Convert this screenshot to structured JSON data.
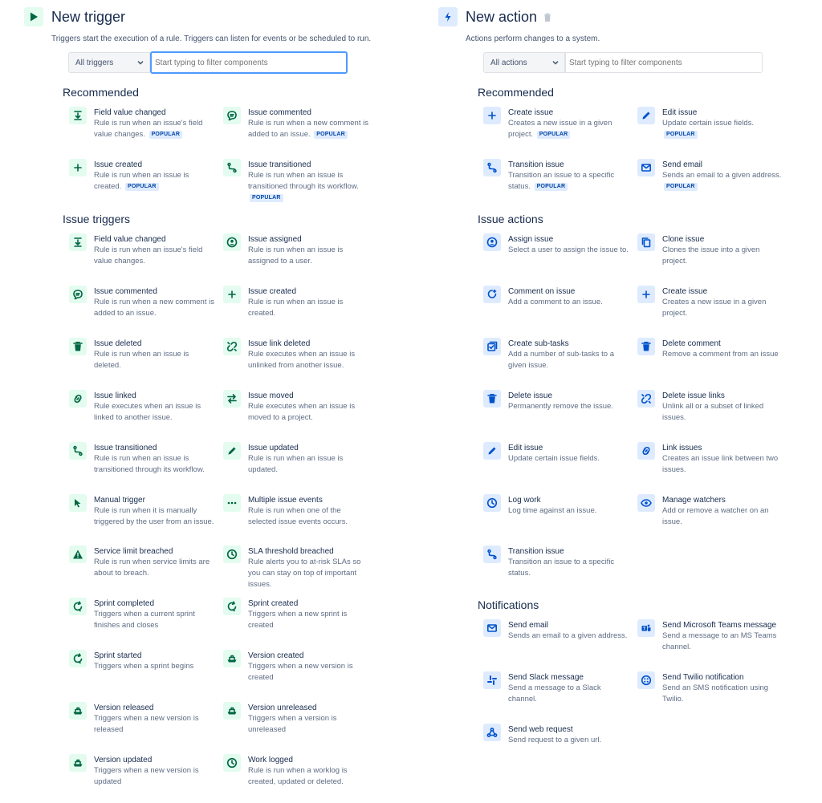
{
  "trigger": {
    "title": "New trigger",
    "description": "Triggers start the execution of a rule. Triggers can listen for events or be scheduled to run.",
    "filter_select": "All triggers",
    "search_placeholder": "Start typing to filter components",
    "recommended_title": "Recommended",
    "issue_triggers_title": "Issue triggers",
    "recommended": [
      {
        "name": "Field value changed",
        "desc": "Rule is run when an issue's field value changes.",
        "badge": "POPULAR",
        "icon": "field-change-icon"
      },
      {
        "name": "Issue commented",
        "desc": "Rule is run when a new comment is added to an issue.",
        "badge": "POPULAR",
        "icon": "comment-icon"
      },
      {
        "name": "Issue created",
        "desc": "Rule is run when an issue is created.",
        "badge": "POPULAR",
        "icon": "plus-icon"
      },
      {
        "name": "Issue transitioned",
        "desc": "Rule is run when an issue is transitioned through its workflow.",
        "badge": "POPULAR",
        "icon": "transition-icon"
      }
    ],
    "issue_triggers": [
      {
        "name": "Field value changed",
        "desc": "Rule is run when an issue's field value changes.",
        "icon": "field-change-icon"
      },
      {
        "name": "Issue assigned",
        "desc": "Rule is run when an issue is assigned to a user.",
        "icon": "user-icon"
      },
      {
        "name": "Issue commented",
        "desc": "Rule is run when a new comment is added to an issue.",
        "icon": "comment-icon"
      },
      {
        "name": "Issue created",
        "desc": "Rule is run when an issue is created.",
        "icon": "plus-icon"
      },
      {
        "name": "Issue deleted",
        "desc": "Rule is run when an issue is deleted.",
        "icon": "trash-icon"
      },
      {
        "name": "Issue link deleted",
        "desc": "Rule executes when an issue is unlinked from another issue.",
        "icon": "unlink-icon"
      },
      {
        "name": "Issue linked",
        "desc": "Rule executes when an issue is linked to another issue.",
        "icon": "link-icon"
      },
      {
        "name": "Issue moved",
        "desc": "Rule executes when an issue is moved to a project.",
        "icon": "move-icon"
      },
      {
        "name": "Issue transitioned",
        "desc": "Rule is run when an issue is transitioned through its workflow.",
        "icon": "transition-icon"
      },
      {
        "name": "Issue updated",
        "desc": "Rule is run when an issue is updated.",
        "icon": "pencil-icon"
      },
      {
        "name": "Manual trigger",
        "desc": "Rule is run when it is manually triggered by the user from an issue.",
        "icon": "cursor-icon"
      },
      {
        "name": "Multiple issue events",
        "desc": "Rule is run when one of the selected issue events occurs.",
        "icon": "more-icon"
      },
      {
        "name": "Service limit breached",
        "desc": "Rule is run when service limits are about to breach.",
        "icon": "warning-icon"
      },
      {
        "name": "SLA threshold breached",
        "desc": "Rule alerts you to at-risk SLAs so you can stay on top of important issues.",
        "icon": "clock-icon"
      },
      {
        "name": "Sprint completed",
        "desc": "Triggers when a current sprint finishes and closes",
        "icon": "sprint-icon"
      },
      {
        "name": "Sprint created",
        "desc": "Triggers when a new sprint is created",
        "icon": "sprint-icon"
      },
      {
        "name": "Sprint started",
        "desc": "Triggers when a sprint begins",
        "icon": "sprint-icon"
      },
      {
        "name": "Version created",
        "desc": "Triggers when a new version is created",
        "icon": "ship-icon"
      },
      {
        "name": "Version released",
        "desc": "Triggers when a new version is released",
        "icon": "ship-icon"
      },
      {
        "name": "Version unreleased",
        "desc": "Triggers when a version is unreleased",
        "icon": "ship-icon"
      },
      {
        "name": "Version updated",
        "desc": "Triggers when a new version is updated",
        "icon": "ship-icon"
      },
      {
        "name": "Work logged",
        "desc": "Rule is run when a worklog is created, updated or deleted.",
        "icon": "clock-icon"
      }
    ]
  },
  "action": {
    "title": "New action",
    "description": "Actions perform changes to a system.",
    "filter_select": "All actions",
    "search_placeholder": "Start typing to filter components",
    "recommended_title": "Recommended",
    "issue_actions_title": "Issue actions",
    "notifications_title": "Notifications",
    "recommended": [
      {
        "name": "Create issue",
        "desc": "Creates a new issue in a given project.",
        "badge": "POPULAR",
        "icon": "plus-icon"
      },
      {
        "name": "Edit issue",
        "desc": "Update certain issue fields.",
        "badge": "POPULAR",
        "icon": "pencil-icon"
      },
      {
        "name": "Transition issue",
        "desc": "Transition an issue to a specific status.",
        "badge": "POPULAR",
        "icon": "transition-icon"
      },
      {
        "name": "Send email",
        "desc": "Sends an email to a given address.",
        "badge": "POPULAR",
        "icon": "email-icon"
      }
    ],
    "issue_actions": [
      {
        "name": "Assign issue",
        "desc": "Select a user to assign the issue to.",
        "icon": "user-icon"
      },
      {
        "name": "Clone issue",
        "desc": "Clones the issue into a given project.",
        "icon": "copy-icon"
      },
      {
        "name": "Comment on issue",
        "desc": "Add a comment to an issue.",
        "icon": "comment-add-icon"
      },
      {
        "name": "Create issue",
        "desc": "Creates a new issue in a given project.",
        "icon": "plus-icon"
      },
      {
        "name": "Create sub-tasks",
        "desc": "Add a number of sub-tasks to a given issue.",
        "icon": "subtask-icon"
      },
      {
        "name": "Delete comment",
        "desc": "Remove a comment from an issue",
        "icon": "trash-icon"
      },
      {
        "name": "Delete issue",
        "desc": "Permanently remove the issue.",
        "icon": "trash-icon"
      },
      {
        "name": "Delete issue links",
        "desc": "Unlink all or a subset of linked issues.",
        "icon": "unlink-icon"
      },
      {
        "name": "Edit issue",
        "desc": "Update certain issue fields.",
        "icon": "pencil-icon"
      },
      {
        "name": "Link issues",
        "desc": "Creates an issue link between two issues.",
        "icon": "link-icon"
      },
      {
        "name": "Log work",
        "desc": "Log time against an issue.",
        "icon": "clock-icon"
      },
      {
        "name": "Manage watchers",
        "desc": "Add or remove a watcher on an issue.",
        "icon": "eye-icon"
      },
      {
        "name": "Transition issue",
        "desc": "Transition an issue to a specific status.",
        "icon": "transition-icon"
      }
    ],
    "notifications": [
      {
        "name": "Send email",
        "desc": "Sends an email to a given address.",
        "icon": "email-icon"
      },
      {
        "name": "Send Microsoft Teams message",
        "desc": "Send a message to an MS Teams channel.",
        "icon": "teams-icon"
      },
      {
        "name": "Send Slack message",
        "desc": "Send a message to a Slack channel.",
        "icon": "slack-icon"
      },
      {
        "name": "Send Twilio notification",
        "desc": "Send an SMS notification using Twilio.",
        "icon": "twilio-icon"
      },
      {
        "name": "Send web request",
        "desc": "Send request to a given url.",
        "icon": "webhook-icon"
      }
    ]
  },
  "colors": {
    "trigger_icon": "#006644",
    "action_icon": "#0052cc",
    "badge": "#0747a6",
    "focus": "#4c9aff"
  }
}
